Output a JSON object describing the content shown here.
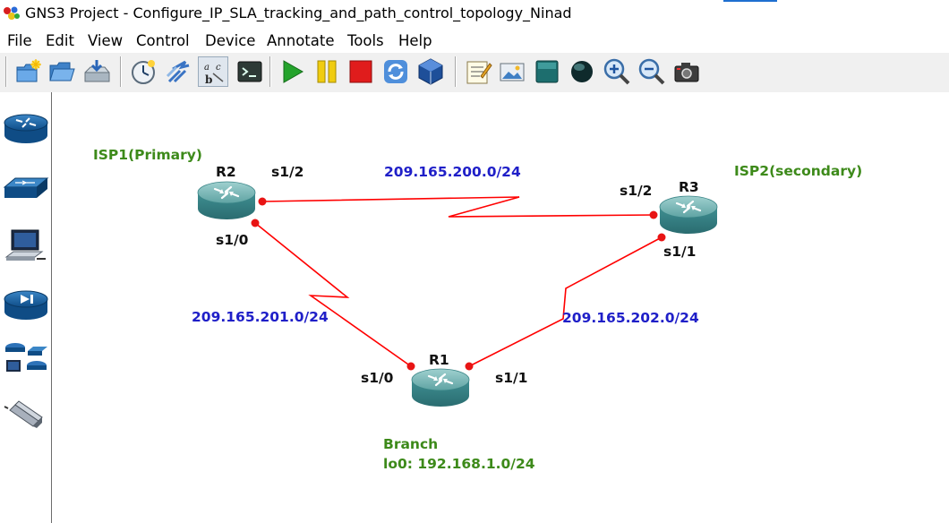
{
  "window": {
    "title": "GNS3 Project - Configure_IP_SLA_tracking_and_path_control_topology_Ninad"
  },
  "menu": {
    "items": [
      {
        "label": "File"
      },
      {
        "label": "Edit"
      },
      {
        "label": "View"
      },
      {
        "label": "Control"
      },
      {
        "label": "Device"
      },
      {
        "label": "Annotate"
      },
      {
        "label": "Tools"
      },
      {
        "label": "Help"
      }
    ]
  },
  "toolbar": {
    "buttons": [
      {
        "icon": "new-project-icon"
      },
      {
        "icon": "open-project-icon"
      },
      {
        "icon": "save-project-icon"
      },
      {
        "icon": "snapshot-icon"
      },
      {
        "icon": "show-interface-labels-icon"
      },
      {
        "icon": "show-names-icon"
      },
      {
        "icon": "console-all-icon"
      },
      {
        "icon": "start-all-icon"
      },
      {
        "icon": "suspend-all-icon"
      },
      {
        "icon": "stop-all-icon"
      },
      {
        "icon": "reload-all-icon"
      },
      {
        "icon": "virtualbox-icon"
      },
      {
        "icon": "add-note-icon"
      },
      {
        "icon": "insert-image-icon"
      },
      {
        "icon": "draw-rectangle-icon"
      },
      {
        "icon": "draw-ellipse-icon"
      },
      {
        "icon": "zoom-in-icon"
      },
      {
        "icon": "zoom-out-icon"
      },
      {
        "icon": "screenshot-icon"
      }
    ]
  },
  "dock": {
    "items": [
      {
        "icon": "routers-icon"
      },
      {
        "icon": "switches-icon"
      },
      {
        "icon": "end-devices-icon"
      },
      {
        "icon": "security-devices-icon"
      },
      {
        "icon": "all-devices-icon"
      },
      {
        "icon": "add-link-icon"
      }
    ]
  },
  "topology": {
    "colors": {
      "link": "#ff0000",
      "port": "#e81414",
      "note_green": "#3d8a1a",
      "note_blue": "#1f1fc8"
    },
    "notes": {
      "isp1": "ISP1(Primary)",
      "isp2": "ISP2(secondary)",
      "branch": "Branch",
      "branch_loopback": "lo0: 192.168.1.0/24"
    },
    "networks": {
      "r2_r3": "209.165.200.0/24",
      "r2_r1": "209.165.201.0/24",
      "r3_r1": "209.165.202.0/24"
    },
    "routers": {
      "r1": {
        "name": "R1",
        "ports": {
          "s1_0": "s1/0",
          "s1_1": "s1/1"
        }
      },
      "r2": {
        "name": "R2",
        "ports": {
          "s1_2": "s1/2",
          "s1_0": "s1/0"
        }
      },
      "r3": {
        "name": "R3",
        "ports": {
          "s1_2": "s1/2",
          "s1_1": "s1/1"
        }
      }
    }
  }
}
